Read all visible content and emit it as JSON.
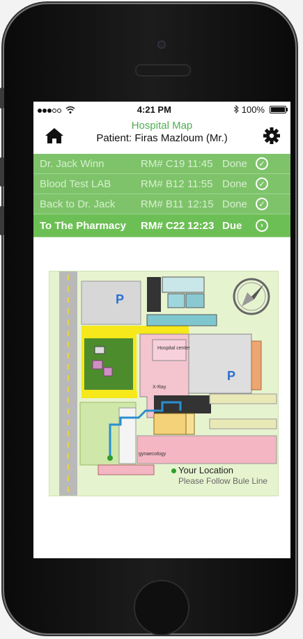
{
  "status_bar": {
    "time": "4:21 PM",
    "battery": "100%",
    "bluetooth_icon": "bluetooth-icon",
    "wifi_icon": "wifi-icon"
  },
  "header": {
    "title": "Hospital Map",
    "patient": "Patient: Firas Mazloum (Mr.)",
    "home_icon": "home-icon",
    "settings_icon": "gear-icon"
  },
  "appointments": [
    {
      "name": "Dr. Jack Winn",
      "room": "RM# C19",
      "time": "11:45",
      "status": "Done",
      "icon": "check-icon"
    },
    {
      "name": "Blood Test LAB",
      "room": "RM# B12",
      "time": "11:55",
      "status": "Done",
      "icon": "check-icon"
    },
    {
      "name": "Back to Dr. Jack",
      "room": "RM# B11",
      "time": "12:15",
      "status": "Done",
      "icon": "check-icon"
    },
    {
      "name": "To The Pharmacy",
      "room": "RM# C22",
      "time": "12:23",
      "status": "Due",
      "icon": "arrow-right-icon"
    }
  ],
  "map": {
    "parking_label_1": "P",
    "parking_label_2": "P",
    "hospital_center": "Hospital center",
    "xray": "X-Ray",
    "gynaecology": "gynaecology",
    "legend_title": "Your Location",
    "legend_sub": "Please Follow Bule Line",
    "compass_icon": "compass-icon"
  },
  "colors": {
    "accent": "#4caf50",
    "row_done": "#7ec36a",
    "row_active": "#6cbf55",
    "route": "#2a8fd1"
  }
}
